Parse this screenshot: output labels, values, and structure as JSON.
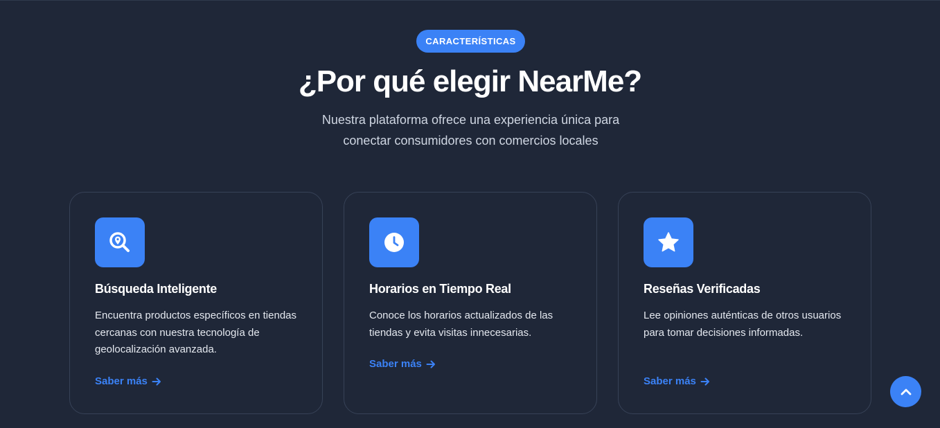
{
  "section": {
    "badge": "CARACTERÍSTICAS",
    "title": "¿Por qué elegir NearMe?",
    "subtitle_line1": "Nuestra plataforma ofrece una experiencia única para",
    "subtitle_line2": "conectar consumidores con comercios locales"
  },
  "features": [
    {
      "icon": "search-location-icon",
      "title": "Búsqueda Inteligente",
      "description": "Encuentra productos específicos en tiendas cercanas con nuestra tecnología de geolocalización avanzada.",
      "link": "Saber más"
    },
    {
      "icon": "clock-icon",
      "title": "Horarios en Tiempo Real",
      "description": "Conoce los horarios actualizados de las tiendas y evita visitas innecesarias.",
      "link": "Saber más"
    },
    {
      "icon": "star-icon",
      "title": "Reseñas Verificadas",
      "description": "Lee opiniones auténticas de otros usuarios para tomar decisiones informadas.",
      "link": "Saber más"
    }
  ],
  "colors": {
    "background": "#1f2738",
    "accent": "#3b82f6",
    "card_border": "#374257"
  },
  "scroll_top_icon": "chevron-up-icon"
}
